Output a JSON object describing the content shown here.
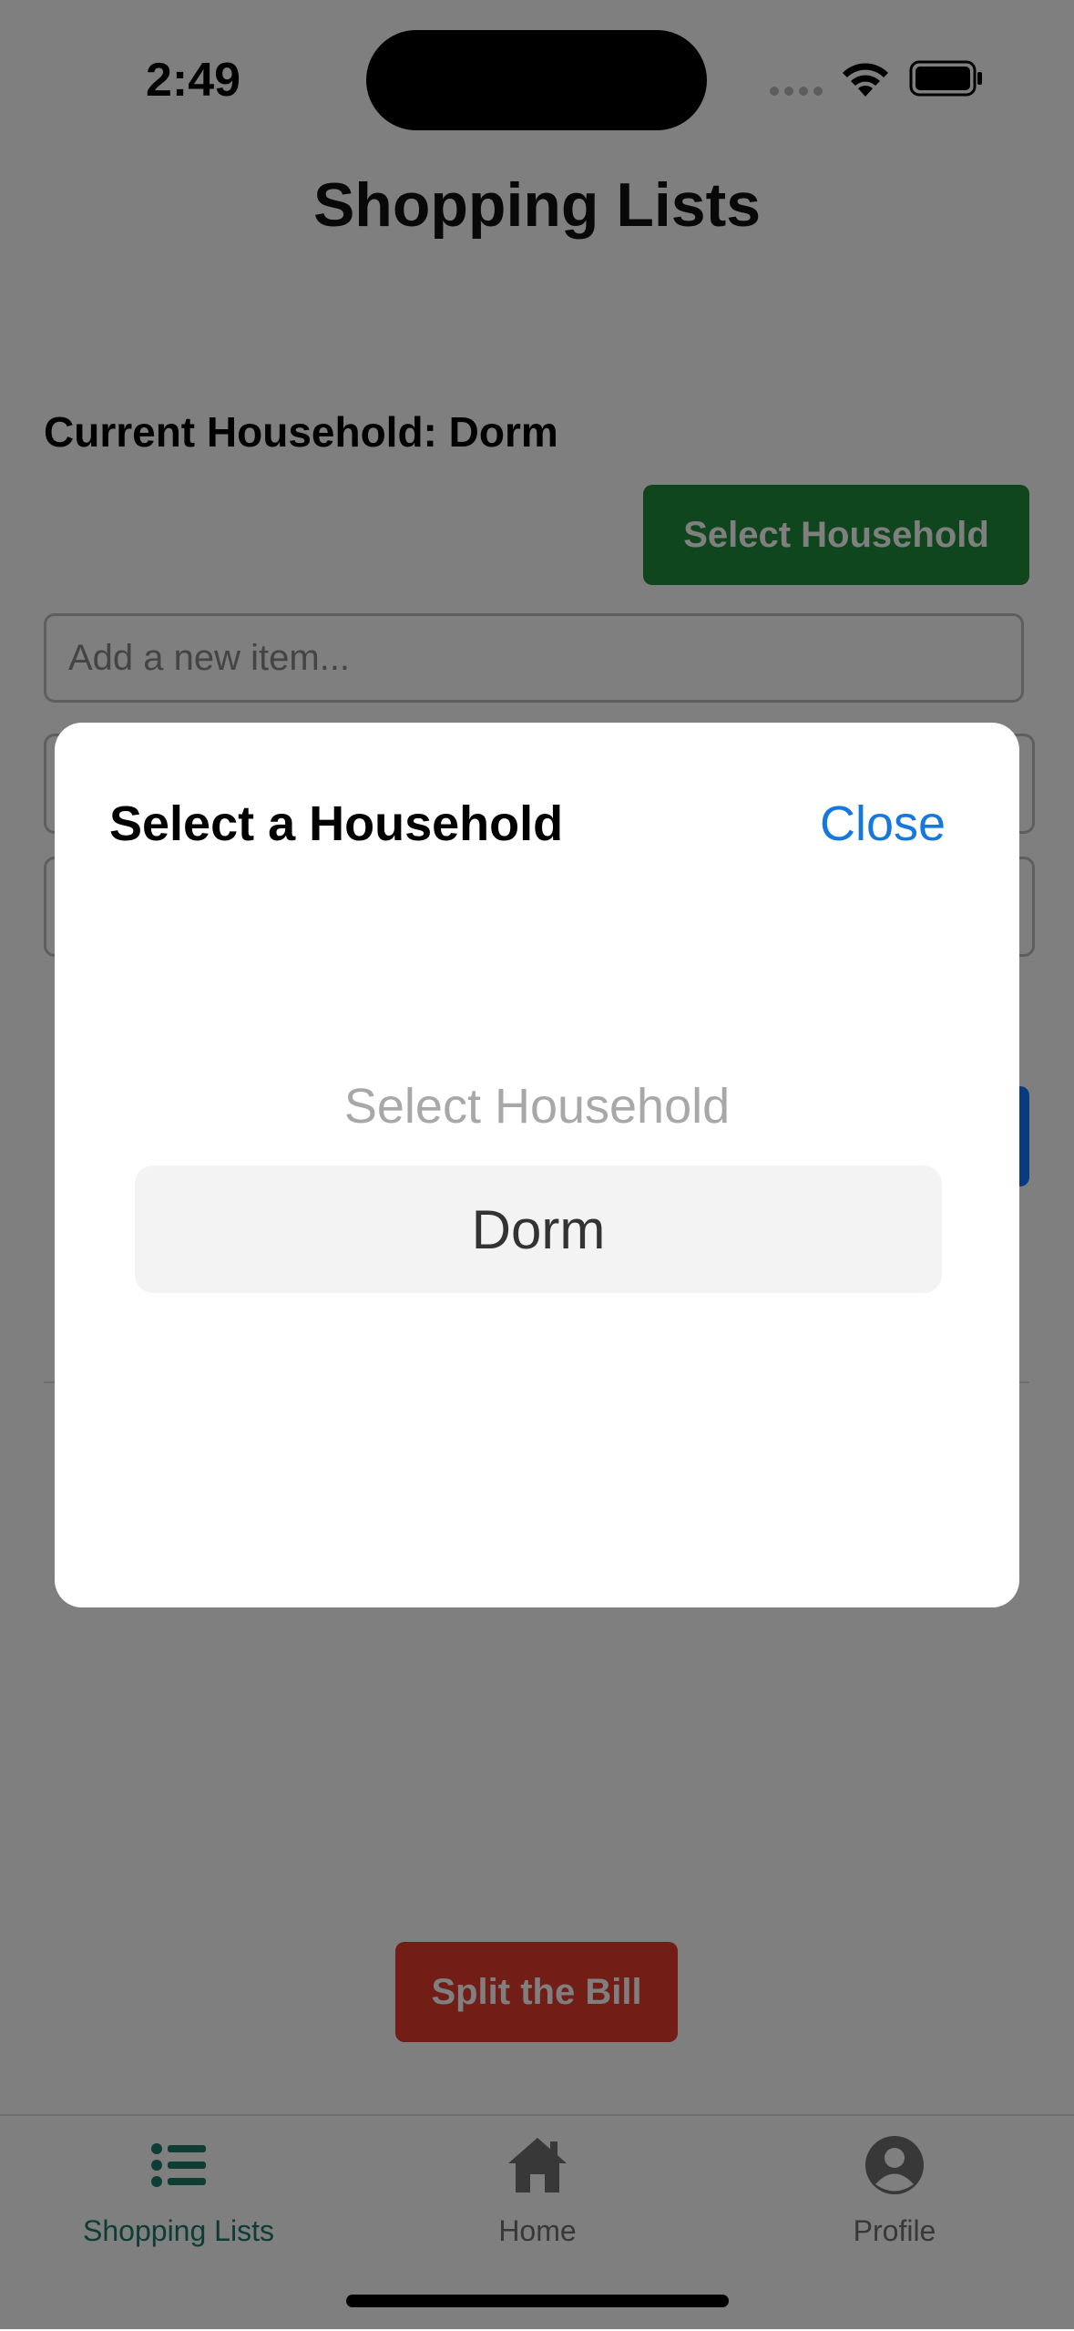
{
  "status_bar": {
    "time": "2:49"
  },
  "header": {
    "title": "Shopping Lists"
  },
  "household": {
    "current_label": "Current Household: Dorm",
    "select_button": "Select Household"
  },
  "item_input": {
    "placeholder": "Add a new item..."
  },
  "actions": {
    "split_bill": "Split the Bill"
  },
  "tabs": [
    {
      "label": "Shopping Lists",
      "icon": "list-icon",
      "active": true
    },
    {
      "label": "Home",
      "icon": "home-icon",
      "active": false
    },
    {
      "label": "Profile",
      "icon": "profile-icon",
      "active": false
    }
  ],
  "modal": {
    "title": "Select a Household",
    "close_label": "Close",
    "picker_label": "Select Household",
    "selected_option": "Dorm"
  },
  "colors": {
    "accent_green": "#1e8c3a",
    "accent_red": "#e53b2c",
    "accent_blue": "#1677dd",
    "tab_active": "#1a7a6a",
    "tab_inactive": "#707070"
  }
}
